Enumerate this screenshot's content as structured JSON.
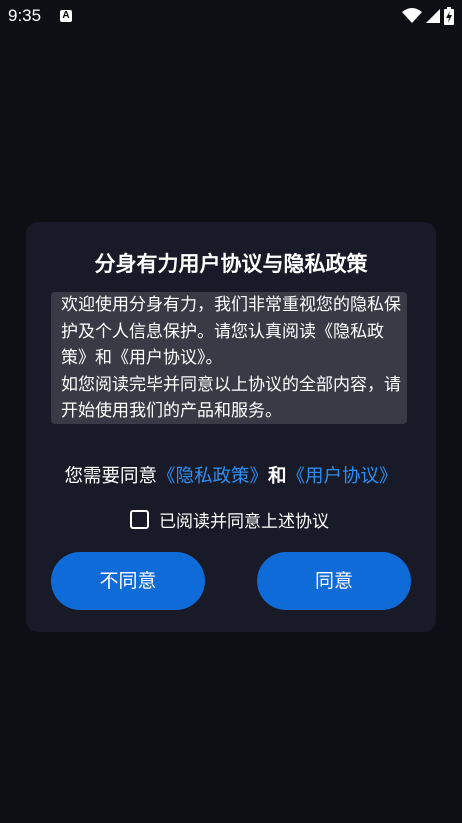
{
  "status_bar": {
    "time": "9:35",
    "notification_icon": "a-icon",
    "icons": [
      "wifi-icon",
      "signal-icon",
      "battery-charging-icon"
    ]
  },
  "dialog": {
    "title": "分身有力用户协议与隐私政策",
    "content": "欢迎使用分身有力，我们非常重视您的隐私保护及个人信息保护。请您认真阅读《隐私政策》和《用户协议》。\n如您阅读完毕并同意以上协议的全部内容，请开始使用我们的产品和服务。",
    "agree_prefix": "您需要同意",
    "privacy_link": "《隐私政策》",
    "and_text": "和",
    "user_agreement_link": "《用户协议》",
    "checkbox_label": "已阅读并同意上述协议",
    "checkbox_checked": false,
    "disagree_button": "不同意",
    "agree_button": "同意"
  },
  "colors": {
    "background": "#0e0f15",
    "dialog_bg": "#191a27",
    "content_bg": "#3a3a46",
    "link": "#2c8ef0",
    "button": "#0f6bd8"
  }
}
